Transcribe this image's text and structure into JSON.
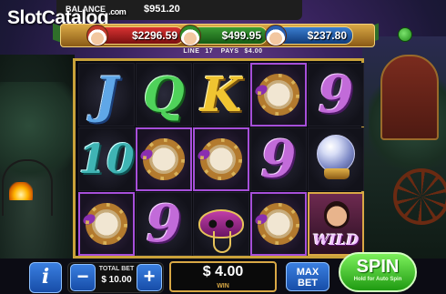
{
  "logo": {
    "part1": "Slot",
    "part2": "Catalog",
    "suffix": ".com"
  },
  "balance": {
    "label": "BALANCE",
    "value": "$951.20"
  },
  "jackpots": [
    {
      "color": "red",
      "value": "$2296.59"
    },
    {
      "color": "green",
      "value": "$499.95"
    },
    {
      "color": "blue",
      "value": "$237.80"
    }
  ],
  "line_info": {
    "line_label": "LINE",
    "line_number": "17",
    "pays_label": "PAYS",
    "pays_value": "$4.00"
  },
  "reels": {
    "symbols": [
      [
        "J",
        "10",
        "tambourine"
      ],
      [
        "Q",
        "tambourine",
        "9"
      ],
      [
        "K",
        "tambourine",
        "mask"
      ],
      [
        "tambourine",
        "9",
        "tambourine"
      ],
      [
        "9",
        "crystal-ball",
        "wild"
      ]
    ],
    "wild_label": "WILD"
  },
  "controls": {
    "info_label": "i",
    "minus_label": "−",
    "plus_label": "+",
    "total_bet_label": "TOTAL BET",
    "total_bet_value": "$ 10.00",
    "win_value": "$ 4.00",
    "win_label": "WIN",
    "max_bet_line1": "MAX",
    "max_bet_line2": "BET",
    "spin_label": "SPIN",
    "spin_sub": "Hold for Auto Spin"
  }
}
